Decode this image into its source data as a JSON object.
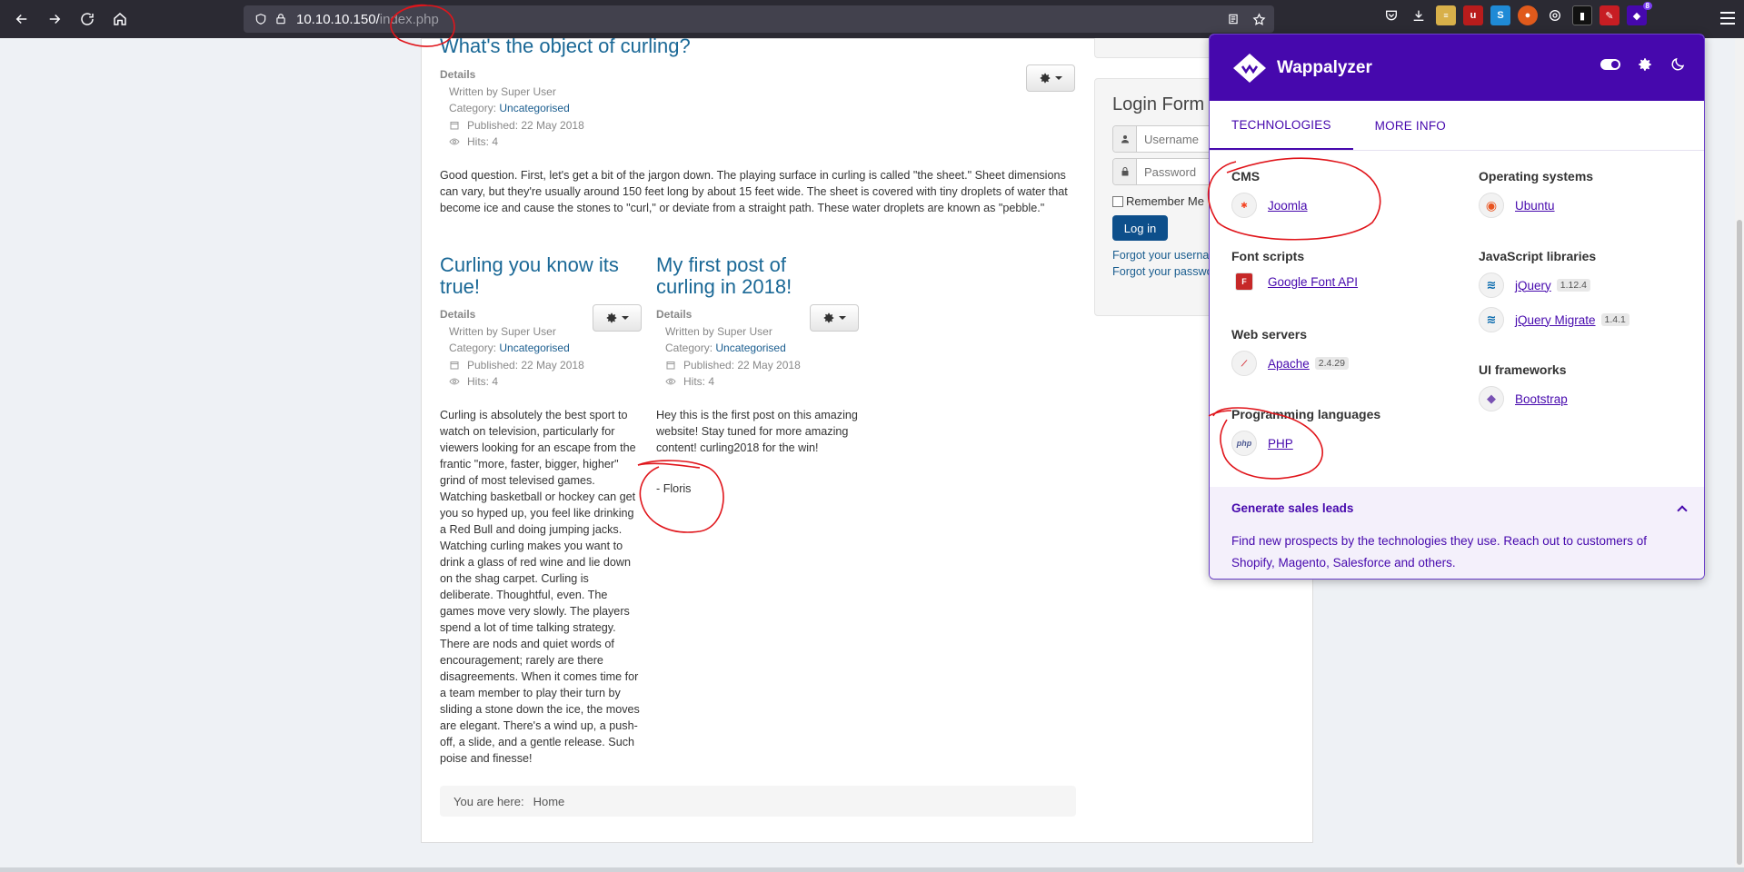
{
  "browser": {
    "url_host": "10.10.10.150/",
    "url_path": "index.php",
    "extension_badge": "8"
  },
  "article_main": {
    "title": "What's the object of curling?",
    "details_label": "Details",
    "written_by": "Written by Super User",
    "category_prefix": "Category: ",
    "category": "Uncategorised",
    "published": "Published: 22 May 2018",
    "hits": "Hits: 4",
    "body": "Good question. First, let's get a bit of the jargon down. The playing surface in curling is called \"the sheet.\" Sheet dimensions can vary, but they're usually around 150 feet long by about 15 feet wide. The sheet is covered with tiny droplets of water that become ice and cause the stones to \"curl,\" or deviate from a straight path. These water droplets are known as \"pebble.\""
  },
  "article_left": {
    "title_line1": "Curling you know its",
    "title_line2": "true!",
    "details_label": "Details",
    "written_by": "Written by Super User",
    "category_prefix": "Category: ",
    "category": "Uncategorised",
    "published": "Published: 22 May 2018",
    "hits": "Hits: 4",
    "body": "Curling is absolutely the best sport to watch on television, particularly for viewers looking for an escape from the frantic \"more, faster, bigger, higher\" grind of most televised games. Watching basketball or hockey can get you so hyped up, you feel like drinking a Red Bull and doing jumping jacks. Watching curling makes you want to drink a glass of red wine and lie down on the shag carpet. Curling is deliberate. Thoughtful, even. The games move very slowly. The players spend a lot of time talking strategy. There are nods and quiet words of encouragement; rarely are there disagreements. When it comes time for a team member to play their turn by sliding a stone down the ice, the moves are elegant. There's a wind up, a push-off, a slide, and a gentle release. Such poise and finesse!"
  },
  "article_right": {
    "title_line1": "My first post of",
    "title_line2": "curling in 2018!",
    "details_label": "Details",
    "written_by": "Written by Super User",
    "category_prefix": "Category: ",
    "category": "Uncategorised",
    "published": "Published: 22 May 2018",
    "hits": "Hits: 4",
    "body": "Hey this is the first post on this amazing website! Stay tuned for more amazing content! curling2018 for the win!",
    "signature": "- Floris"
  },
  "breadcrumb": {
    "prefix": "You are here:",
    "home": "Home"
  },
  "login": {
    "title": "Login Form",
    "username_placeholder": "Username",
    "password_placeholder": "Password",
    "remember": "Remember Me",
    "button": "Log in",
    "forgot_username": "Forgot your username?",
    "forgot_password": "Forgot your password?"
  },
  "wappalyzer": {
    "title": "Wappalyzer",
    "tabs": [
      "TECHNOLOGIES",
      "MORE INFO"
    ],
    "left": [
      {
        "category": "CMS",
        "items": [
          {
            "name": "Joomla",
            "version": "",
            "icon": "joomla-icon"
          }
        ]
      },
      {
        "category": "Font scripts",
        "items": [
          {
            "name": "Google Font API",
            "version": "",
            "icon": "google-font-icon"
          }
        ]
      },
      {
        "category": "Web servers",
        "items": [
          {
            "name": "Apache",
            "version": "2.4.29",
            "icon": "apache-icon"
          }
        ]
      },
      {
        "category": "Programming languages",
        "items": [
          {
            "name": "PHP",
            "version": "",
            "icon": "php-icon"
          }
        ]
      }
    ],
    "right": [
      {
        "category": "Operating systems",
        "items": [
          {
            "name": "Ubuntu",
            "version": "",
            "icon": "ubuntu-icon"
          }
        ]
      },
      {
        "category": "JavaScript libraries",
        "items": [
          {
            "name": "jQuery",
            "version": "1.12.4",
            "icon": "jquery-icon"
          },
          {
            "name": "jQuery Migrate",
            "version": "1.4.1",
            "icon": "jquery-icon"
          }
        ]
      },
      {
        "category": "UI frameworks",
        "items": [
          {
            "name": "Bootstrap",
            "version": "",
            "icon": "bootstrap-icon"
          }
        ]
      }
    ],
    "footer_title": "Generate sales leads",
    "footer_text": "Find new prospects by the technologies they use. Reach out to customers of Shopify, Magento, Salesforce and others."
  },
  "colors": {
    "wappalyzer_purple": "#4608ad",
    "link_blue": "#1a6896",
    "annotation_red": "#e0151b"
  }
}
